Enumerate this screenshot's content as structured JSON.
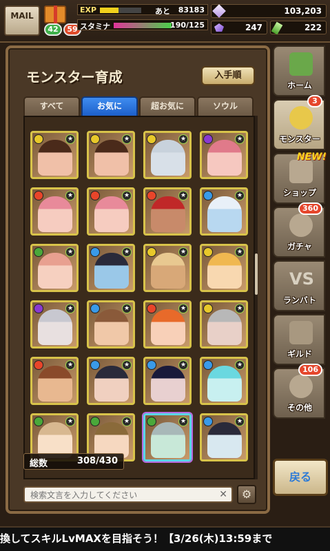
{
  "header": {
    "mail_label": "MAIL",
    "badge_green": "42",
    "badge_red": "59",
    "exp_label": "EXP",
    "exp_remaining_label": "あと",
    "exp_value": "83183",
    "exp_fill": 0.45,
    "stamina_label": "スタミナ",
    "stamina_value": "190/125",
    "stamina_fill": 1.0,
    "resources": [
      {
        "icon": "crystal-icon",
        "value": "103,203"
      },
      {
        "icon": "orb-icon",
        "value": "247"
      },
      {
        "icon": "stone-icon",
        "value": "222"
      }
    ]
  },
  "panel": {
    "title": "モンスター育成",
    "sort_label": "入手順",
    "tabs": [
      {
        "label": "すべて",
        "active": false
      },
      {
        "label": "お気に",
        "active": true
      },
      {
        "label": "超お気に",
        "active": false
      },
      {
        "label": "ソウル",
        "active": false
      }
    ],
    "count_label": "総数",
    "count_value": "308/430",
    "search_placeholder": "検索文言を入力してください",
    "monsters": [
      {
        "element": "light",
        "skin": "#f0c0a8",
        "hair": "#4a2a1a"
      },
      {
        "element": "light",
        "skin": "#f0c0a8",
        "hair": "#4a2a1a"
      },
      {
        "element": "light",
        "skin": "#d8e0e8",
        "hair": "#c8d2dc"
      },
      {
        "element": "dark",
        "skin": "#f6c8c0",
        "hair": "#e07a8a"
      },
      {
        "element": "fire",
        "skin": "#f6ccc0",
        "hair": "#e88a9a"
      },
      {
        "element": "fire",
        "skin": "#f6ccc0",
        "hair": "#e88a9a"
      },
      {
        "element": "fire",
        "skin": "#c88a6a",
        "hair": "#c02828"
      },
      {
        "element": "water",
        "skin": "#b8d8f0",
        "hair": "#e8f0f8"
      },
      {
        "element": "wood",
        "skin": "#f6d0c0",
        "hair": "#e8a090"
      },
      {
        "element": "water",
        "skin": "#9ac8e8",
        "hair": "#2a2a3a"
      },
      {
        "element": "light",
        "skin": "#d8a878",
        "hair": "#e8c890"
      },
      {
        "element": "light",
        "skin": "#f8d8b0",
        "hair": "#f0b850"
      },
      {
        "element": "dark",
        "skin": "#e8e0e0",
        "hair": "#c8c8d0"
      },
      {
        "element": "water",
        "skin": "#f0c8a8",
        "hair": "#8a5a3a"
      },
      {
        "element": "fire",
        "skin": "#f8d0b8",
        "hair": "#e86a2a"
      },
      {
        "element": "light",
        "skin": "#e8d0c8",
        "hair": "#b8b8b8"
      },
      {
        "element": "fire",
        "skin": "#e8b890",
        "hair": "#8a4a2a"
      },
      {
        "element": "water",
        "skin": "#f0d0c0",
        "hair": "#2a2a3a"
      },
      {
        "element": "water",
        "skin": "#e8d0d0",
        "hair": "#1a1a3a"
      },
      {
        "element": "water",
        "skin": "#c8f0f0",
        "hair": "#6ad8e0"
      },
      {
        "element": "wood",
        "skin": "#f8e0c8",
        "hair": "#d8b890"
      },
      {
        "element": "wood",
        "skin": "#f6d8c0",
        "hair": "#8a6a3a"
      },
      {
        "element": "wood",
        "skin": "#c8e8d8",
        "hair": "#a8b8b8"
      },
      {
        "element": "water",
        "skin": "#d8e8f0",
        "hair": "#2a2a3a"
      }
    ]
  },
  "nav": [
    {
      "label": "ホーム",
      "icon": "home-icon",
      "badge": ""
    },
    {
      "label": "モンスター",
      "icon": "monster-icon",
      "badge": "3"
    },
    {
      "label": "ショップ",
      "icon": "shop-icon",
      "badge": "",
      "new": "NEW!"
    },
    {
      "label": "ガチャ",
      "icon": "gacha-icon",
      "badge": "360"
    },
    {
      "label": "ランバト",
      "icon": "vs-icon",
      "badge": ""
    },
    {
      "label": "ギルド",
      "icon": "guild-icon",
      "badge": ""
    },
    {
      "label": "その他",
      "icon": "gear-icon",
      "badge": "106"
    }
  ],
  "back_label": "戻る",
  "ticker": "換してスキルLvMAXを目指そう！【3/26(木)13:59まで"
}
